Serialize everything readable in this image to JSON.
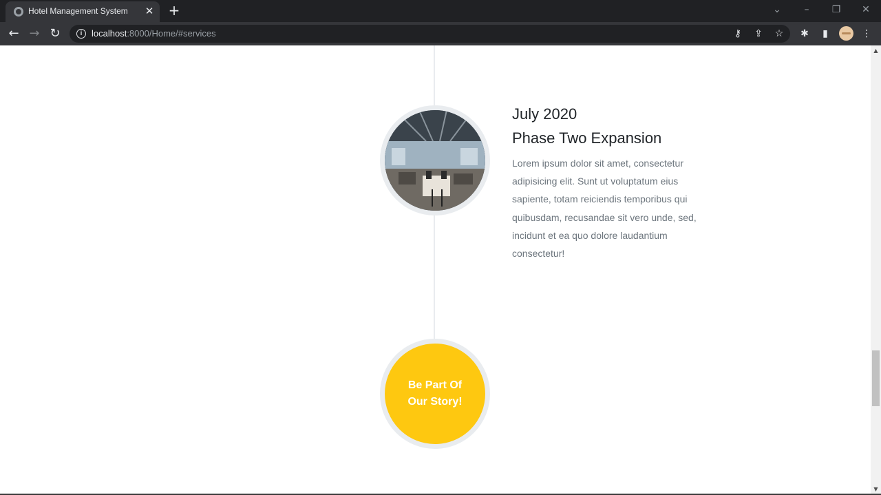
{
  "browser": {
    "tab_title": "Hotel Management System",
    "url_host": "localhost",
    "url_rest": ":8000/Home/#services"
  },
  "timeline": {
    "date": "July 2020",
    "heading": "Phase Two Expansion",
    "description": "Lorem ipsum dolor sit amet, consectetur adipisicing elit. Sunt ut voluptatum eius sapiente, totam reiciendis temporibus qui quibusdam, recusandae sit vero unde, sed, incidunt et ea quo dolore laudantium consectetur!",
    "cta_text": "Be Part Of Our Story!"
  },
  "colors": {
    "accent": "#fec810",
    "timeline_line": "#e9ecef",
    "chrome_dark": "#202124"
  }
}
